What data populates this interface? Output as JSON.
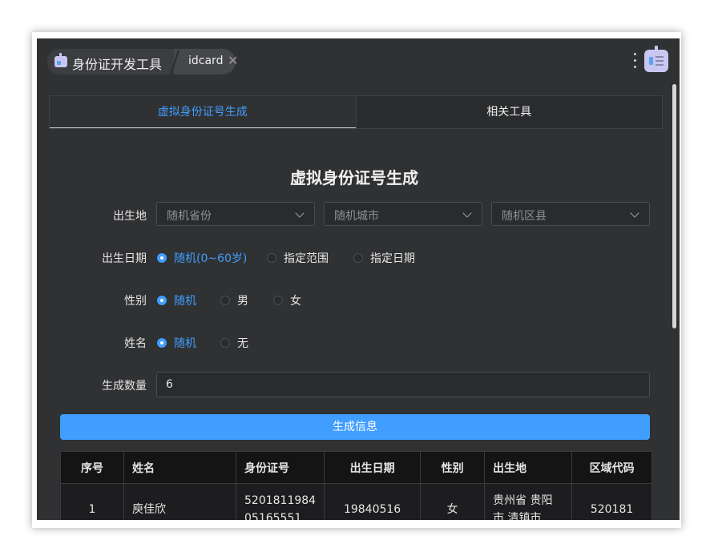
{
  "header": {
    "app_name": "身份证开发工具",
    "tab_name": "idcard",
    "tab_close": "✕"
  },
  "tabs": [
    {
      "label": "虚拟身份证号生成",
      "active": true
    },
    {
      "label": "相关工具",
      "active": false
    }
  ],
  "form": {
    "title": "虚拟身份证号生成",
    "birthplace": {
      "label": "出生地",
      "province_placeholder": "随机省份",
      "city_placeholder": "随机城市",
      "district_placeholder": "随机区县"
    },
    "birthdate": {
      "label": "出生日期",
      "options": [
        "随机(0~60岁)",
        "指定范围",
        "指定日期"
      ],
      "selected": "随机(0~60岁)"
    },
    "gender": {
      "label": "性别",
      "options": [
        "随机",
        "男",
        "女"
      ],
      "selected": "随机"
    },
    "name": {
      "label": "姓名",
      "options": [
        "随机",
        "无"
      ],
      "selected": "随机"
    },
    "count": {
      "label": "生成数量",
      "value": "6"
    },
    "generate_button": "生成信息"
  },
  "table": {
    "columns": [
      "序号",
      "姓名",
      "身份证号",
      "出生日期",
      "性别",
      "出生地",
      "区域代码"
    ],
    "rows": [
      {
        "index": "1",
        "name": "庾佳欣",
        "id_line1": "5201811984",
        "id_line2": "05165551",
        "birthdate": "19840516",
        "gender": "女",
        "place_line1": "贵州省 贵阳",
        "place_line2": "市 清镇市",
        "code": "520181"
      }
    ]
  },
  "colors": {
    "accent": "#409eff",
    "background": "#303133"
  }
}
